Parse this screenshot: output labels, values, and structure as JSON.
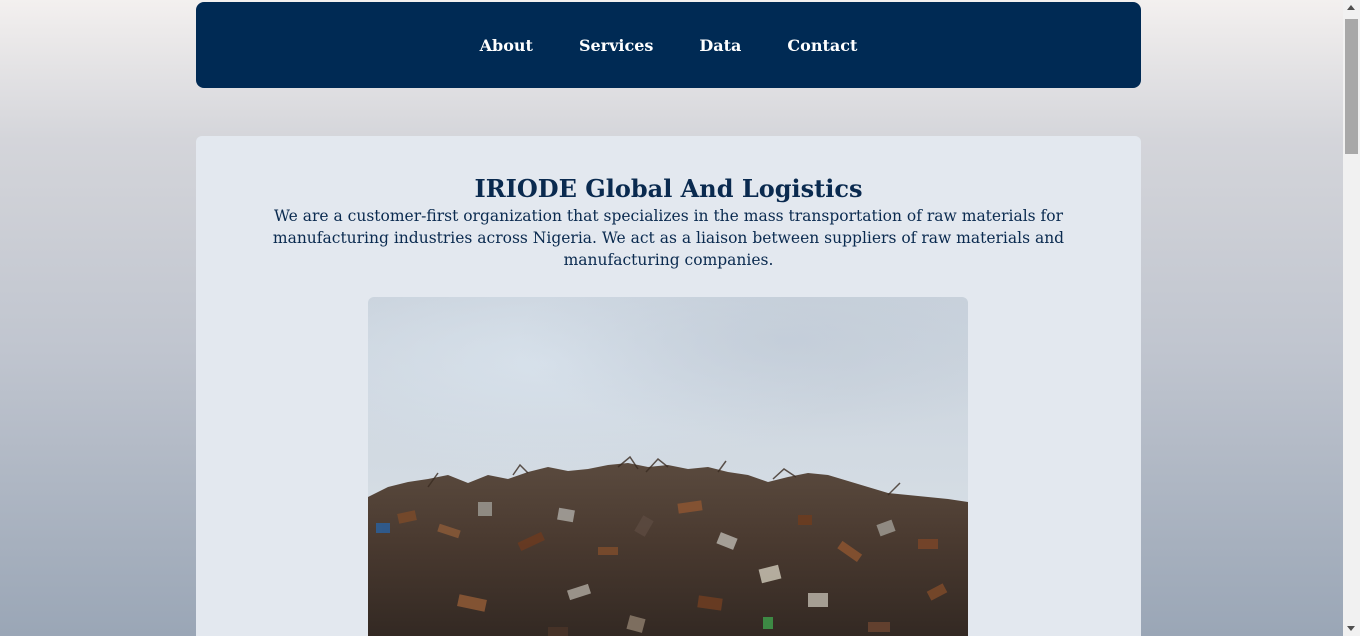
{
  "nav": {
    "items": [
      {
        "label": "About"
      },
      {
        "label": "Services"
      },
      {
        "label": "Data"
      },
      {
        "label": "Contact"
      }
    ]
  },
  "main": {
    "title": "IRIODE Global And Logistics",
    "description": "We are a customer-first organization that specializes in the mass transportation of raw materials for manufacturing industries across Nigeria. We act as a liaison between suppliers of raw materials and manufacturing companies.",
    "image_subject": "scrap-metal-heap-under-cloudy-sky"
  },
  "colors": {
    "nav_background": "#002a54",
    "card_background": "#e3e8ef",
    "text_primary": "#0a2a4f",
    "nav_text": "#ffffff"
  }
}
